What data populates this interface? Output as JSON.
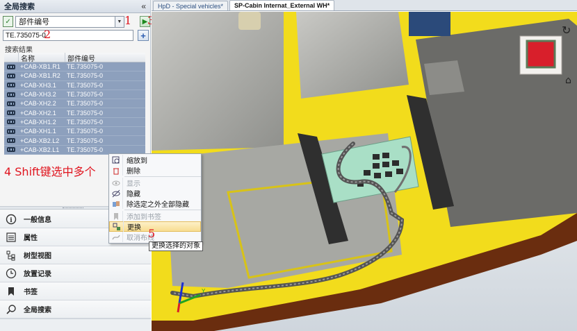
{
  "panel": {
    "title": "全局搜索",
    "collapse_glyph": "«"
  },
  "search": {
    "field_select": "部件编号",
    "query_value": "TE.735075-0",
    "results_label": "搜索结果",
    "columns": [
      "名称",
      "部件编号"
    ],
    "rows": [
      {
        "name": "+CAB-XB1.R1",
        "part": "TE.735075-0"
      },
      {
        "name": "+CAB-XB1.R2",
        "part": "TE.735075-0"
      },
      {
        "name": "+CAB-XH3.1",
        "part": "TE.735075-0"
      },
      {
        "name": "+CAB-XH3.2",
        "part": "TE.735075-0"
      },
      {
        "name": "+CAB-XH2.2",
        "part": "TE.735075-0"
      },
      {
        "name": "+CAB-XH2.1",
        "part": "TE.735075-0"
      },
      {
        "name": "+CAB-XH1.2",
        "part": "TE.735075-0"
      },
      {
        "name": "+CAB-XH1.1",
        "part": "TE.735075-0"
      },
      {
        "name": "+CAB-XB2.L2",
        "part": "TE.735075-0"
      },
      {
        "name": "+CAB-XB2.L1",
        "part": "TE.735075-0"
      }
    ]
  },
  "annotations": {
    "n1": "1",
    "n2": "2",
    "n3": "3",
    "n5": "5",
    "n4_text": "4 Shift键选中多个"
  },
  "nav": [
    {
      "label": "一般信息",
      "icon": "info-icon"
    },
    {
      "label": "属性",
      "icon": "properties-icon"
    },
    {
      "label": "树型视图",
      "icon": "tree-view-icon"
    },
    {
      "label": "放置记录",
      "icon": "history-icon"
    },
    {
      "label": "书签",
      "icon": "bookmark-icon"
    },
    {
      "label": "全局搜索",
      "icon": "search-icon"
    }
  ],
  "tabs": [
    {
      "label": "HpD - Special vehicles*",
      "active": false
    },
    {
      "label": "SP-Cabin Internat_External WH*",
      "active": true
    }
  ],
  "context_menu": {
    "items": [
      {
        "label": "缩放到",
        "icon": "zoom-to-icon",
        "disabled": false
      },
      {
        "label": "删除",
        "icon": "delete-icon",
        "disabled": false
      },
      {
        "label": "显示",
        "icon": "show-icon",
        "disabled": true
      },
      {
        "label": "隐藏",
        "icon": "hide-icon",
        "disabled": false
      },
      {
        "label": "除选定之外全部隐藏",
        "icon": "hide-others-icon",
        "disabled": false
      },
      {
        "label": "添加到书签",
        "icon": "add-bookmark-icon",
        "disabled": true
      },
      {
        "label": "更换",
        "icon": "replace-icon",
        "disabled": false,
        "highlighted": true
      },
      {
        "label": "取消布线",
        "icon": "unroute-icon",
        "disabled": true
      }
    ],
    "tooltip": "更换选择的对象"
  },
  "colors": {
    "accent_red": "#e0141e",
    "selection_row": "#8da0bd",
    "cabin_yellow": "#f2dc1c",
    "frame_brown": "#6a2d0f"
  }
}
